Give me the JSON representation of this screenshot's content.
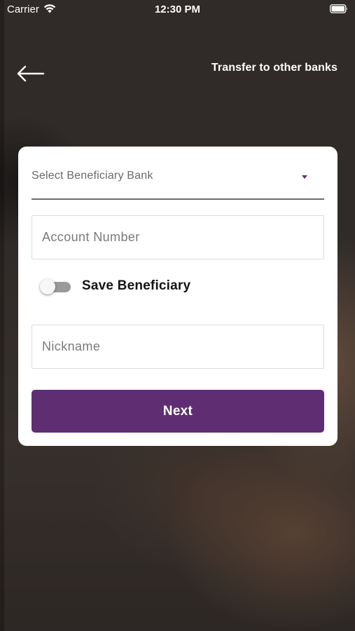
{
  "status_bar": {
    "carrier": "Carrier",
    "time": "12:30 PM",
    "wifi_icon": "wifi-icon",
    "battery_icon": "battery-icon"
  },
  "header": {
    "back_icon": "arrow-left-icon",
    "title": "Transfer to other banks"
  },
  "form": {
    "bank_select": {
      "placeholder": "Select Beneficiary Bank",
      "value": ""
    },
    "account_number": {
      "placeholder": "Account Number",
      "value": ""
    },
    "save_beneficiary": {
      "label": "Save Beneficiary",
      "enabled": false
    },
    "nickname": {
      "placeholder": "Nickname",
      "value": ""
    },
    "next_label": "Next"
  },
  "colors": {
    "primary": "#5f2e72",
    "caret": "#5e2e74",
    "card_background": "#ffffff",
    "toggle_off": "#9a9a9a"
  }
}
